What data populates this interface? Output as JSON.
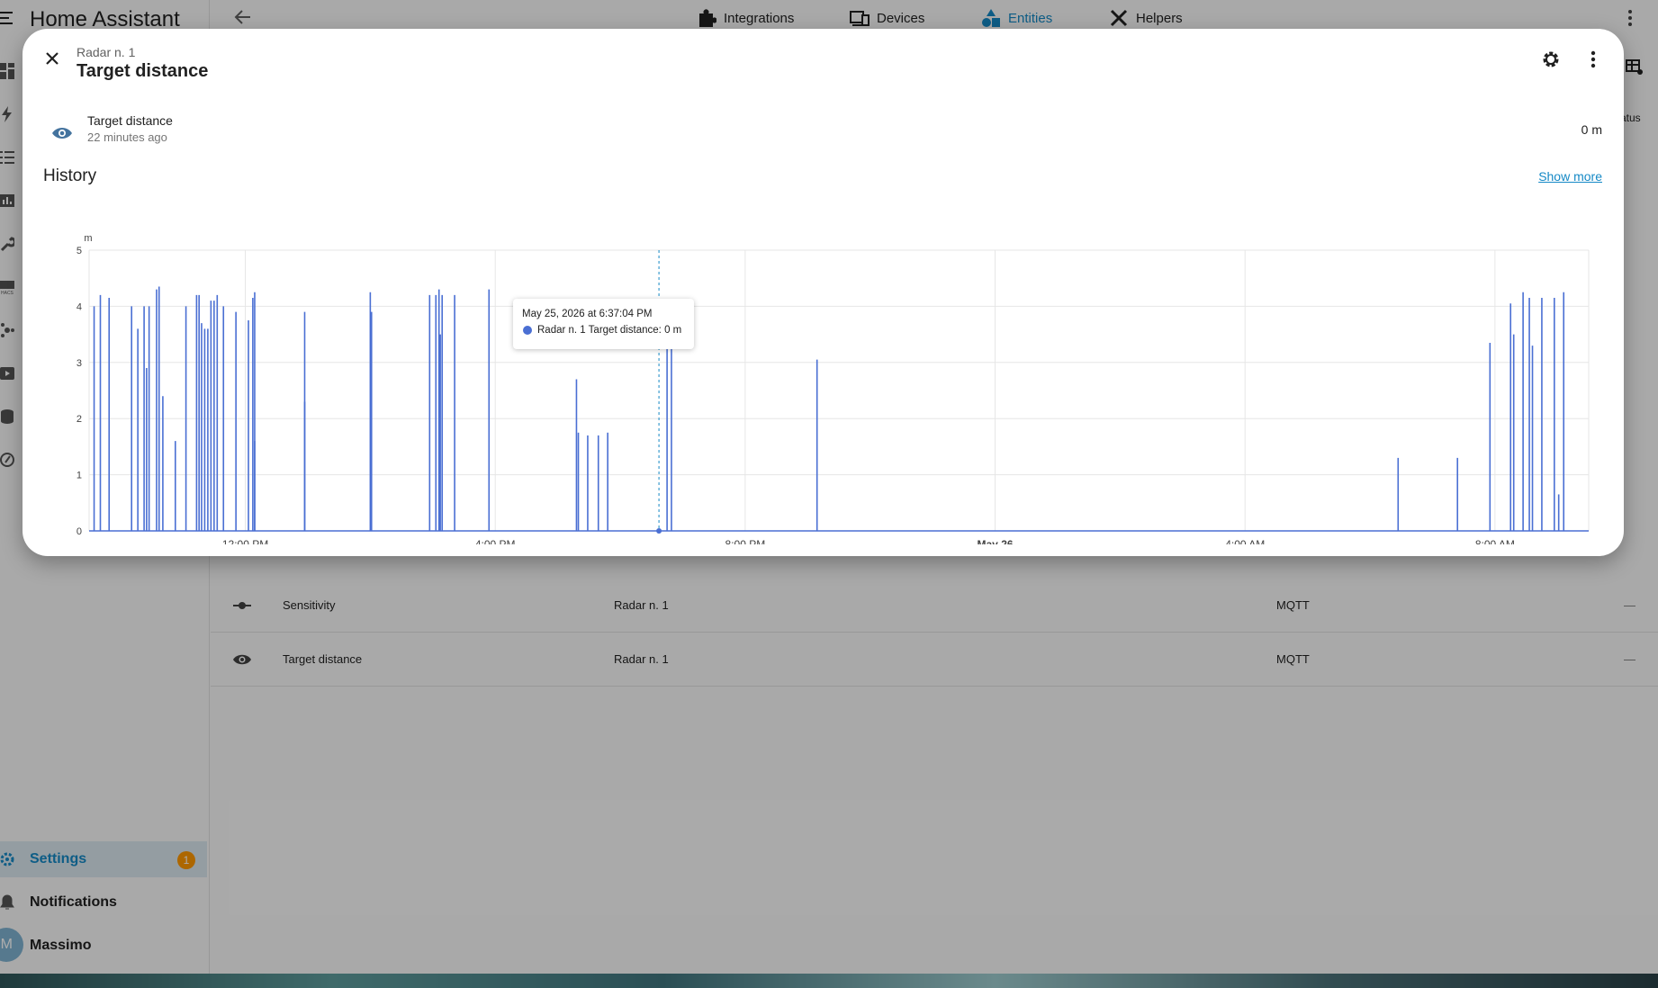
{
  "app": {
    "title": "Home Assistant",
    "sidebar": {
      "settings_label": "Settings",
      "settings_badge": "1",
      "notifications_label": "Notifications",
      "user_label": "Massimo",
      "user_initial": "M"
    },
    "tabs": [
      {
        "label": "Integrations",
        "icon": "puzzle-icon",
        "active": false
      },
      {
        "label": "Devices",
        "icon": "devices-icon",
        "active": false
      },
      {
        "label": "Entities",
        "icon": "shapes-icon",
        "active": true
      },
      {
        "label": "Helpers",
        "icon": "tools-icon",
        "active": false
      }
    ],
    "right_strip_text": "atus",
    "entity_rows": [
      {
        "icon": "slider-icon",
        "name": "Sensitivity",
        "device": "Radar n. 1",
        "integration": "MQTT",
        "status": "—"
      },
      {
        "icon": "eye-icon",
        "name": "Target distance",
        "device": "Radar n. 1",
        "integration": "MQTT",
        "status": "—"
      }
    ]
  },
  "dialog": {
    "subtitle": "Radar n. 1",
    "title": "Target distance",
    "state": {
      "name": "Target distance",
      "last_changed": "22 minutes ago",
      "value": "0 m"
    },
    "history_title": "History",
    "show_more": "Show more",
    "tooltip": {
      "time": "May 25, 2026 at 6:37:04 PM",
      "series": "Radar n. 1 Target distance: 0 m"
    }
  },
  "colors": {
    "accent": "#1589c6",
    "series": "#4a6fd3",
    "badge": "#ff9800"
  },
  "chart_data": {
    "type": "line",
    "title": "",
    "xlabel": "",
    "ylabel": "m",
    "ylim": [
      0,
      5
    ],
    "yticks": [
      "0",
      "1",
      "2",
      "3",
      "4",
      "5"
    ],
    "xlim_hours": [
      9.5,
      33.5
    ],
    "xticks": [
      {
        "label": "12:00 PM",
        "hour": 12,
        "bold": false
      },
      {
        "label": "4:00 PM",
        "hour": 16,
        "bold": false
      },
      {
        "label": "8:00 PM",
        "hour": 20,
        "bold": false
      },
      {
        "label": "May 26",
        "hour": 24,
        "bold": true
      },
      {
        "label": "4:00 AM",
        "hour": 28,
        "bold": false
      },
      {
        "label": "8:00 AM",
        "hour": 32,
        "bold": false
      }
    ],
    "grid": true,
    "cursor_hour": 18.62,
    "series": [
      {
        "name": "Radar n. 1 Target distance",
        "spikes": [
          {
            "hour": 9.58,
            "value": 4.0
          },
          {
            "hour": 9.68,
            "value": 4.2
          },
          {
            "hour": 9.82,
            "value": 4.15
          },
          {
            "hour": 10.18,
            "value": 4.0
          },
          {
            "hour": 10.28,
            "value": 3.6
          },
          {
            "hour": 10.38,
            "value": 4.0
          },
          {
            "hour": 10.42,
            "value": 2.9
          },
          {
            "hour": 10.46,
            "value": 4.0
          },
          {
            "hour": 10.58,
            "value": 4.3
          },
          {
            "hour": 10.62,
            "value": 4.35
          },
          {
            "hour": 10.68,
            "value": 2.4
          },
          {
            "hour": 10.88,
            "value": 1.6
          },
          {
            "hour": 11.05,
            "value": 4.0
          },
          {
            "hour": 11.22,
            "value": 4.2
          },
          {
            "hour": 11.26,
            "value": 4.2
          },
          {
            "hour": 11.3,
            "value": 3.7
          },
          {
            "hour": 11.35,
            "value": 3.6
          },
          {
            "hour": 11.4,
            "value": 3.6
          },
          {
            "hour": 11.45,
            "value": 4.1
          },
          {
            "hour": 11.5,
            "value": 4.1
          },
          {
            "hour": 11.55,
            "value": 4.2
          },
          {
            "hour": 11.65,
            "value": 4.0
          },
          {
            "hour": 11.85,
            "value": 3.9
          },
          {
            "hour": 12.05,
            "value": 3.75
          },
          {
            "hour": 12.12,
            "value": 4.15
          },
          {
            "hour": 12.15,
            "value": 4.25
          },
          {
            "hour": 12.15,
            "value": 1.6
          },
          {
            "hour": 12.95,
            "value": 3.9
          },
          {
            "hour": 12.95,
            "value": 2.3
          },
          {
            "hour": 14.0,
            "value": 4.25
          },
          {
            "hour": 14.02,
            "value": 3.9
          },
          {
            "hour": 14.95,
            "value": 4.2
          },
          {
            "hour": 15.05,
            "value": 4.2
          },
          {
            "hour": 15.1,
            "value": 4.3
          },
          {
            "hour": 15.12,
            "value": 3.5
          },
          {
            "hour": 15.15,
            "value": 4.2
          },
          {
            "hour": 15.35,
            "value": 4.2
          },
          {
            "hour": 15.9,
            "value": 4.3
          },
          {
            "hour": 17.3,
            "value": 2.7
          },
          {
            "hour": 17.33,
            "value": 1.75
          },
          {
            "hour": 17.48,
            "value": 1.7
          },
          {
            "hour": 17.65,
            "value": 1.7
          },
          {
            "hour": 17.8,
            "value": 1.75
          },
          {
            "hour": 18.75,
            "value": 3.6
          },
          {
            "hour": 18.82,
            "value": 3.6
          },
          {
            "hour": 21.15,
            "value": 3.05
          },
          {
            "hour": 30.45,
            "value": 1.3
          },
          {
            "hour": 31.4,
            "value": 1.3
          },
          {
            "hour": 31.92,
            "value": 3.35
          },
          {
            "hour": 32.25,
            "value": 4.05
          },
          {
            "hour": 32.3,
            "value": 3.5
          },
          {
            "hour": 32.45,
            "value": 4.25
          },
          {
            "hour": 32.55,
            "value": 4.15
          },
          {
            "hour": 32.6,
            "value": 3.3
          },
          {
            "hour": 32.75,
            "value": 4.15
          },
          {
            "hour": 32.95,
            "value": 4.15
          },
          {
            "hour": 33.02,
            "value": 0.65
          },
          {
            "hour": 33.1,
            "value": 4.25
          }
        ]
      }
    ]
  }
}
